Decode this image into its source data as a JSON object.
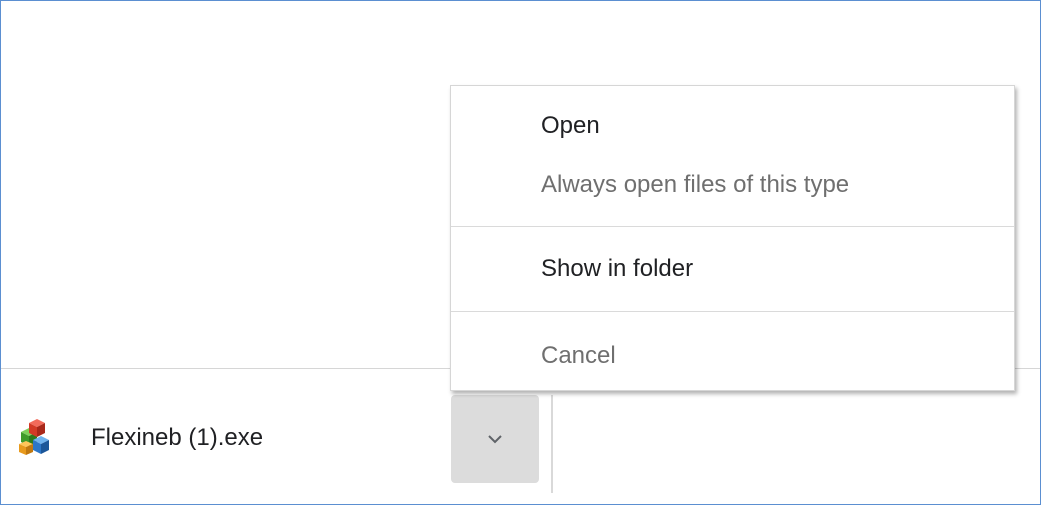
{
  "download": {
    "file_name": "Flexineb (1).exe",
    "icon": "application-cubes-icon",
    "dropdown_icon": "chevron-down-icon"
  },
  "context_menu": {
    "items": [
      {
        "label": "Open",
        "enabled": true
      },
      {
        "label": "Always open files of this type",
        "enabled": false
      },
      {
        "label": "Show in folder",
        "enabled": true
      },
      {
        "label": "Cancel",
        "enabled": false
      }
    ]
  },
  "colors": {
    "window_border": "#5b8fd1",
    "dropdown_button_bg": "#dcdcdc",
    "menu_text": "#202124",
    "menu_text_disabled": "#6f6f6f"
  }
}
